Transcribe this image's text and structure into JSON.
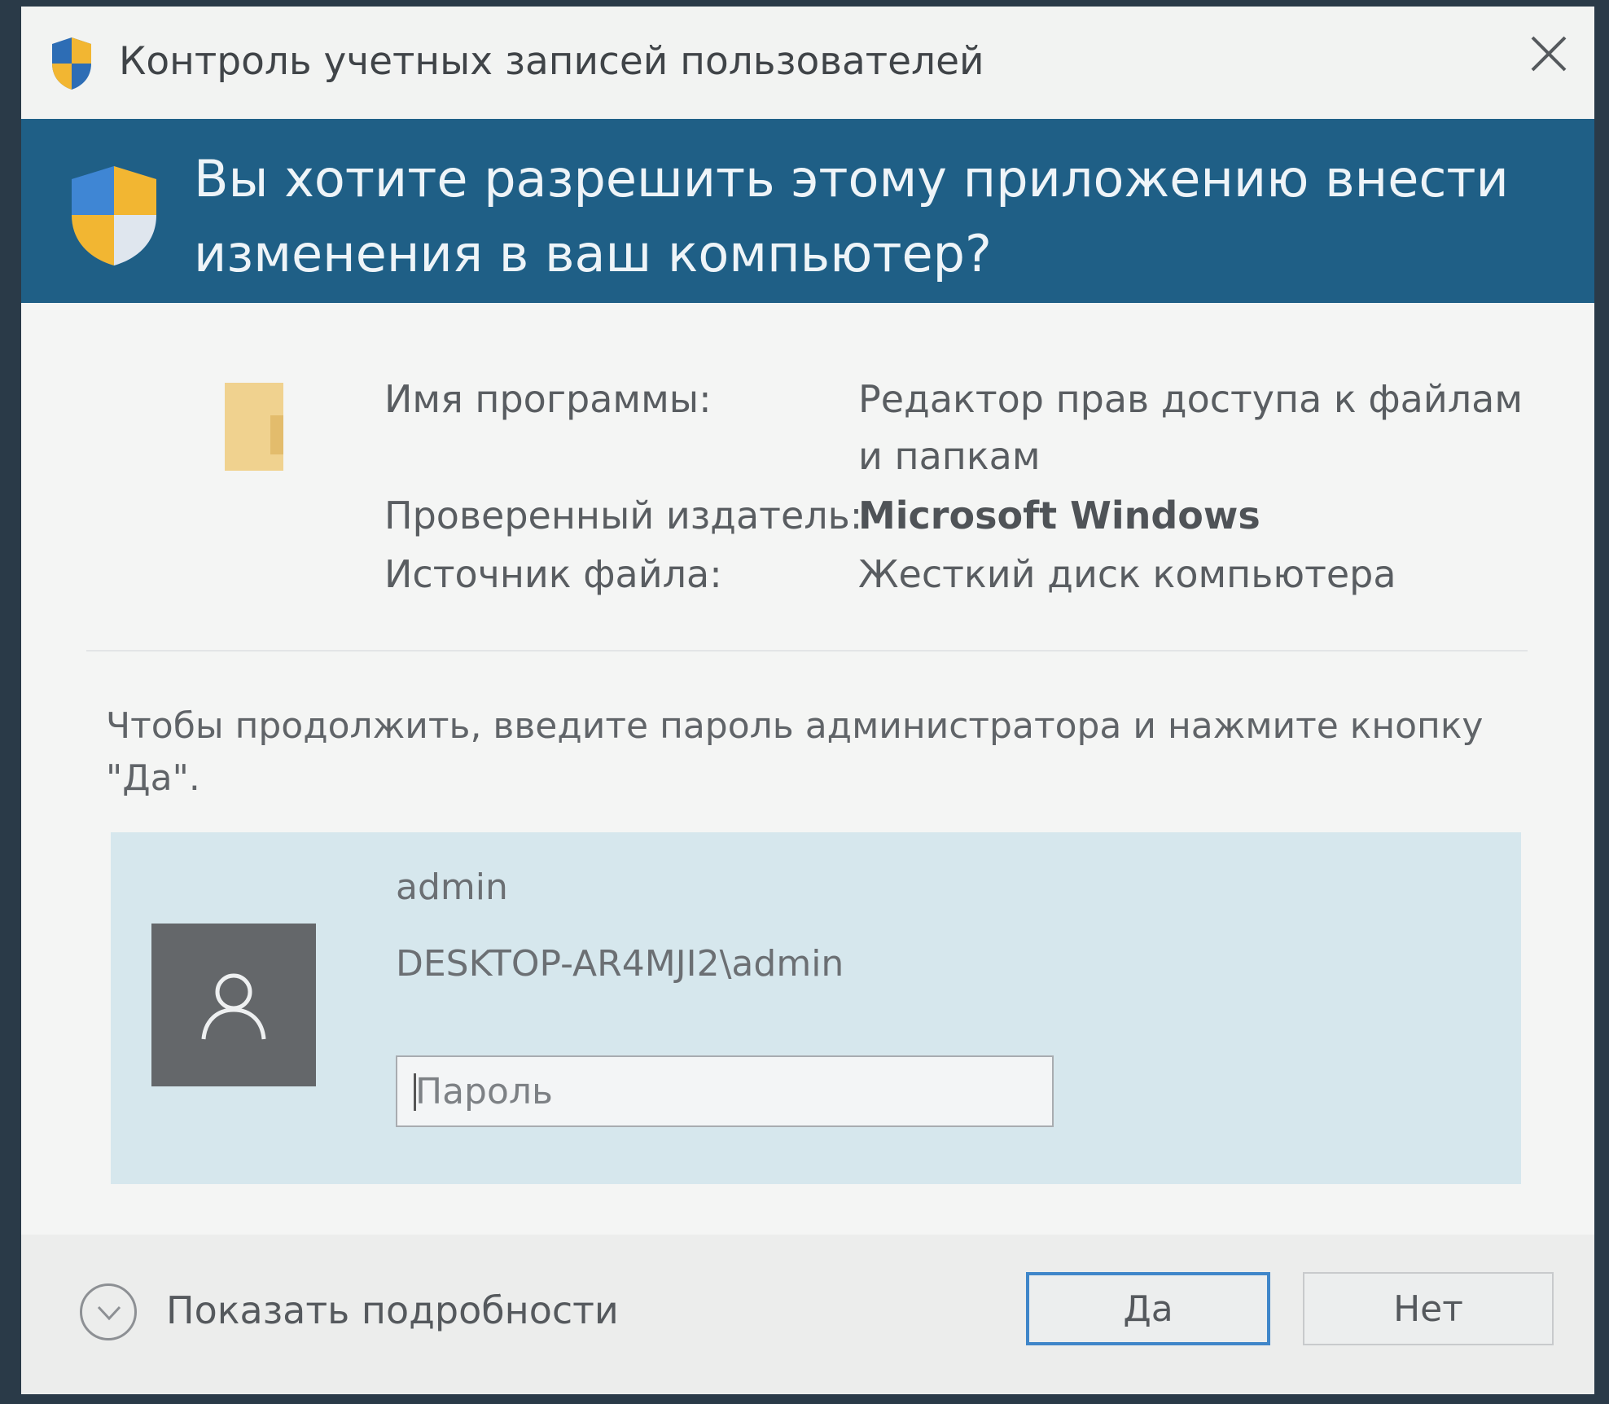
{
  "window": {
    "title": "Контроль учетных записей пользователей",
    "close_icon": "close-icon"
  },
  "banner": {
    "question": "Вы хотите разрешить этому приложению внести изменения в ваш компьютер?",
    "icon": "uac-shield-icon"
  },
  "info": {
    "program_label": "Имя программы:",
    "program_value": "Редактор прав доступа к файлам и папкам",
    "publisher_label": "Проверенный издатель:",
    "publisher_value": "Microsoft Windows",
    "source_label": "Источник файла:",
    "source_value": "Жесткий диск компьютера"
  },
  "prompt": "Чтобы продолжить, введите пароль администратора и нажмите кнопку \"Да\".",
  "account": {
    "name": "admin",
    "domain_user": "DESKTOP-AR4MJI2\\admin",
    "password_placeholder": "Пароль",
    "password_value": ""
  },
  "footer": {
    "details_label": "Показать подробности",
    "yes_label": "Да",
    "no_label": "Нет"
  },
  "colors": {
    "banner": "#1f5f86",
    "account_panel": "#d6e7ed",
    "focus_border": "#3f86c9",
    "shield_blue": "#2d6db5",
    "shield_yellow": "#f2b632"
  }
}
